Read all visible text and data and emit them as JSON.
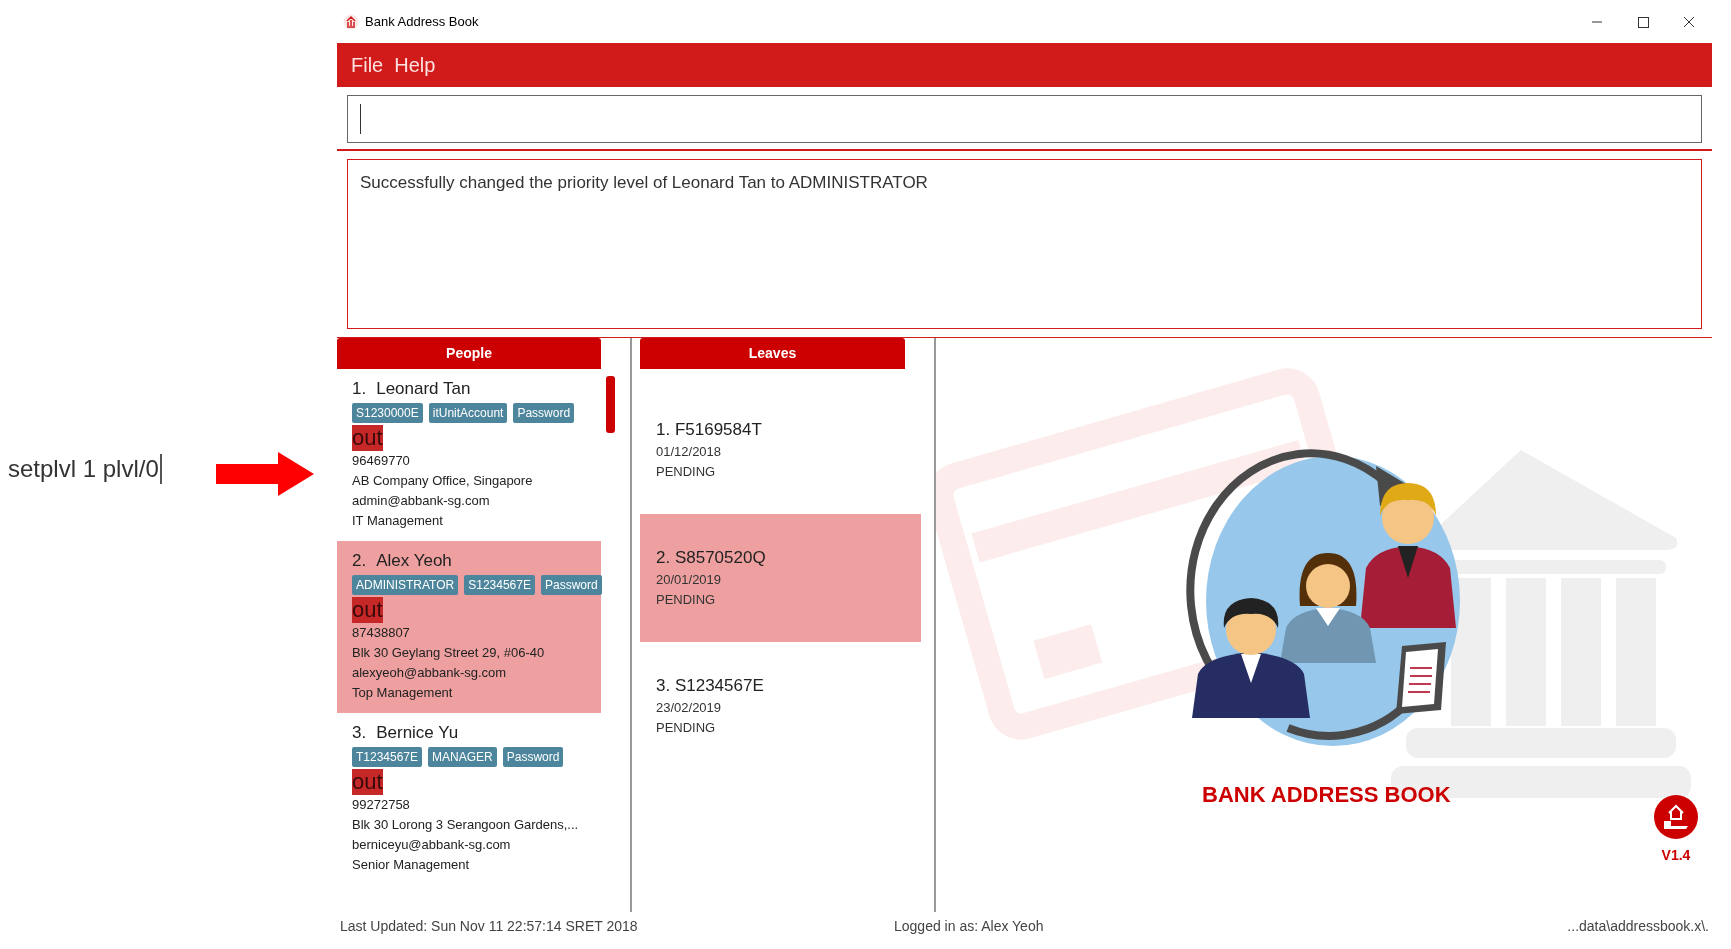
{
  "annotation": {
    "command": "setplvl 1 plvl/0"
  },
  "window": {
    "title": "Bank Address Book"
  },
  "menu": [
    "File",
    "Help"
  ],
  "result_display": {
    "text": "Successfully changed the priority level of Leonard Tan to ADMINISTRATOR"
  },
  "people_panel": {
    "title": "People",
    "people": [
      {
        "index": "1.",
        "name": "Leonard Tan",
        "tags": [
          "S1230000E",
          "itUnitAccount",
          "Password"
        ],
        "status": "out",
        "phone": "96469770",
        "address": "AB Company Office, Singapore",
        "email": "admin@abbank-sg.com",
        "department": "IT Management",
        "selected": false
      },
      {
        "index": "2.",
        "name": "Alex Yeoh",
        "tags": [
          "ADMINISTRATOR",
          "S1234567E",
          "Password"
        ],
        "status": "out",
        "phone": "87438807",
        "address": "Blk 30 Geylang Street 29, #06-40",
        "email": "alexyeoh@abbank-sg.com",
        "department": "Top Management",
        "selected": true
      },
      {
        "index": "3.",
        "name": "Bernice Yu",
        "tags": [
          "T1234567E",
          "MANAGER",
          "Password"
        ],
        "status": "out",
        "phone": "99272758",
        "address": "Blk 30 Lorong 3 Serangoon Gardens,...",
        "email": "berniceyu@abbank-sg.com",
        "department": "Senior Management",
        "selected": false
      }
    ]
  },
  "leaves_panel": {
    "title": "Leaves",
    "leaves": [
      {
        "title": "1. F5169584T",
        "date": "01/12/2018",
        "status": "PENDING",
        "selected": false
      },
      {
        "title": "2. S8570520Q",
        "date": "20/01/2019",
        "status": "PENDING",
        "selected": true
      },
      {
        "title": "3. S1234567E",
        "date": "23/02/2019",
        "status": "PENDING",
        "selected": false
      }
    ]
  },
  "branding": {
    "title": "BANK ADDRESS BOOK",
    "version": "V1.4"
  },
  "status_bar": {
    "last_updated": "Last Updated: Sun Nov 11 22:57:14 SRET 2018",
    "logged_in": "Logged in as: Alex Yeoh",
    "file_path": "...data\\addressbook.x\\."
  }
}
